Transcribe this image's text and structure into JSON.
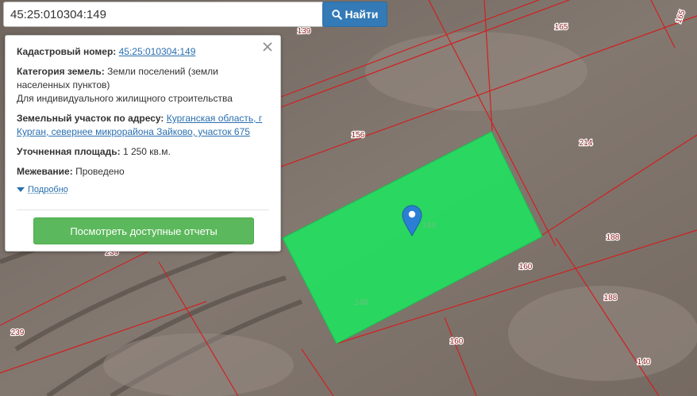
{
  "search": {
    "value": "45:25:010304:149",
    "button_label": "Найти",
    "button_icon": "search-icon",
    "button_color": "#337ab7"
  },
  "popup": {
    "cadastral_label": "Кадастровый номер:",
    "cadastral_value": "45:25:010304:149",
    "category_label": "Категория земель:",
    "category_value_line1": "Земли поселений (земли",
    "category_value_line2": "населенных пунктов)",
    "usage": "Для индивидуального жилищного строительства",
    "address_label": "Земельный участок по адресу:",
    "address_line1": "Курганская область, г",
    "address_line2": "Курган, севернее микрорайона Зайково, участок 675",
    "area_label": "Уточненная площадь:",
    "area_value": "1 250 кв.м.",
    "survey_label": "Межевание:",
    "survey_value": "Проведено",
    "more_label": "Подробно",
    "report_button": "Посмотреть доступные отчеты",
    "report_button_color": "#5cb85c",
    "close_icon": "close-icon"
  },
  "map": {
    "highlight_color": "#22e060",
    "boundary_color": "#d02020",
    "marker_color": "#2a7fd4",
    "parcel_labels": {
      "p139_top": "139",
      "p165_a": "165",
      "p165_b": "165",
      "p156": "156",
      "p214": "214",
      "p149_marker": "149",
      "p149_lower": "149",
      "p188_a": "188",
      "p188_b": "188",
      "p160_a": "160",
      "p160_b": "160",
      "p239": "239",
      "p140": "140",
      "p239_hidden": "239"
    }
  }
}
